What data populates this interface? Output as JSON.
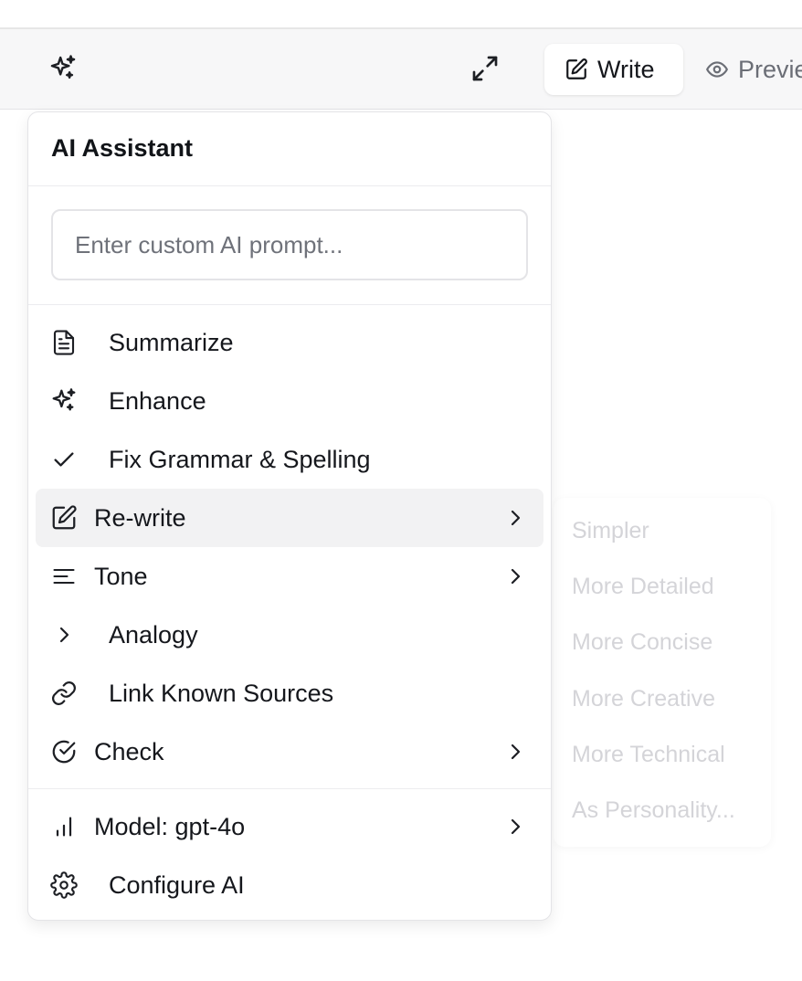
{
  "toolbar": {
    "write_label": "Write",
    "preview_label": "Preview"
  },
  "menu": {
    "title": "AI Assistant",
    "prompt_placeholder": "Enter custom AI prompt...",
    "items": [
      {
        "label": "Summarize",
        "icon": "document-icon"
      },
      {
        "label": "Enhance",
        "icon": "sparkles-icon"
      },
      {
        "label": "Fix Grammar & Spelling",
        "icon": "check-icon"
      },
      {
        "label": "Re-write",
        "icon": "pencil-square-icon",
        "submenu": true,
        "active": true
      },
      {
        "label": "Tone",
        "icon": "align-left-icon",
        "submenu": true
      },
      {
        "label": "Analogy",
        "icon": "chevron-right-icon"
      },
      {
        "label": "Link Known Sources",
        "icon": "link-icon"
      },
      {
        "label": "Check",
        "icon": "check-circle-icon",
        "submenu": true
      }
    ],
    "footer_items": [
      {
        "label": "Model: gpt-4o",
        "icon": "bar-chart-icon",
        "submenu": true
      },
      {
        "label": "Configure AI",
        "icon": "gear-icon"
      }
    ]
  },
  "rewrite_submenu": {
    "items": [
      "Simpler",
      "More Detailed",
      "More Concise",
      "More Creative",
      "More Technical",
      "As Personality..."
    ]
  },
  "colors": {
    "toolbar_bg": "#f7f7f8",
    "active_item_bg": "#f2f2f3",
    "submenu_text": "#d4d4d8"
  }
}
